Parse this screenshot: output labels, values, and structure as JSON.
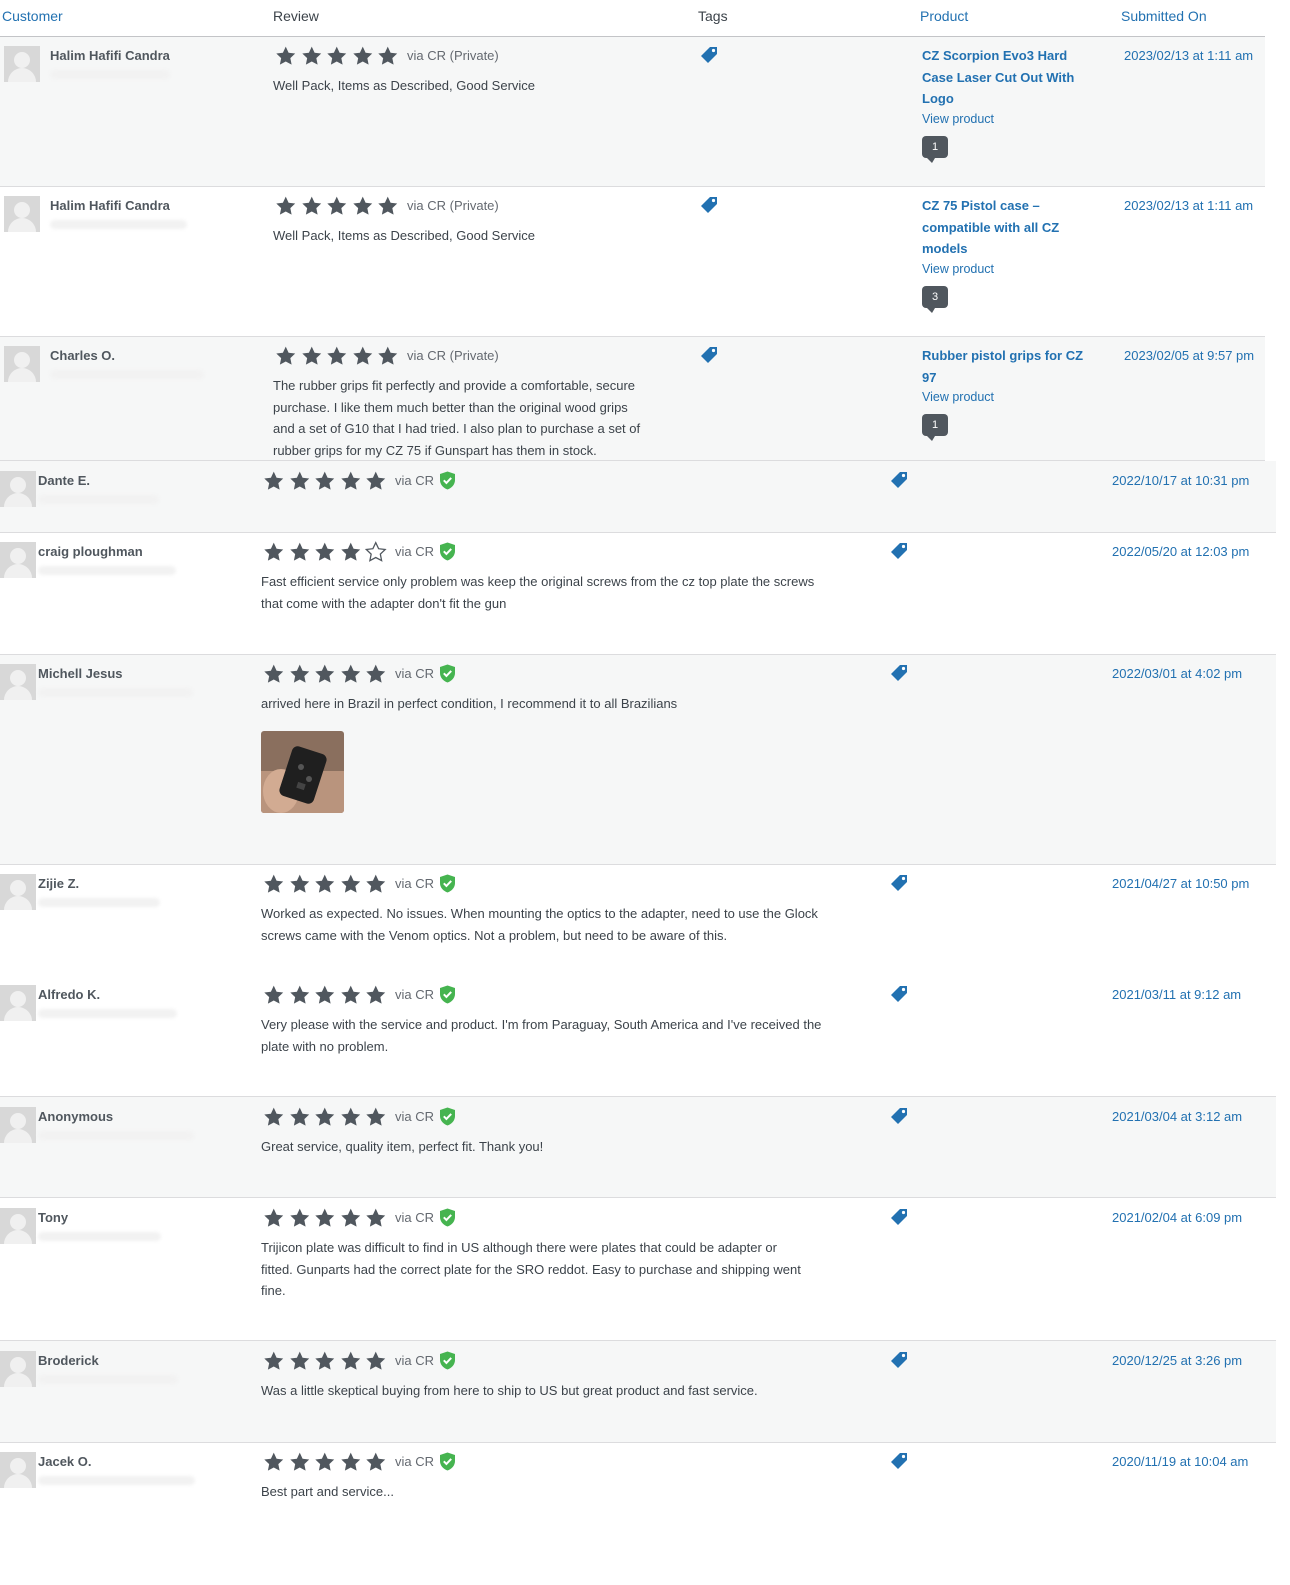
{
  "header": {
    "customer": "Customer",
    "review": "Review",
    "tags": "Tags",
    "product": "Product",
    "submitted": "Submitted On"
  },
  "colors": {
    "link": "#2271b1",
    "star": "#50575e",
    "verified": "#46b450",
    "bubble": "#50575e"
  },
  "icons": {
    "tag": "tag-icon",
    "verified": "verified-shield-icon",
    "avatar": "default-avatar-icon"
  },
  "reviews": [
    {
      "name": "Halim Hafifi Candra",
      "rating": 5,
      "via": "via CR (Private)",
      "verified": false,
      "text": "Well Pack, Items as Described, Good Service",
      "product": [
        "CZ Scorpion Evo3 Hard",
        "Case Laser Cut Out With",
        "Logo"
      ],
      "view": "View product",
      "count": "1",
      "date": "2023/02/13 at 1:11 am"
    },
    {
      "name": "Halim Hafifi Candra",
      "rating": 5,
      "via": "via CR (Private)",
      "verified": false,
      "text": "Well Pack, Items as Described, Good Service",
      "product": [
        "CZ 75 Pistol case –",
        "compatible with all CZ",
        "models"
      ],
      "view": "View product",
      "count": "3",
      "date": "2023/02/13 at 1:11 am"
    },
    {
      "name": "Charles O.",
      "rating": 5,
      "via": "via CR (Private)",
      "verified": false,
      "lines": [
        "The rubber grips fit perfectly and provide a comfortable, secure",
        "purchase. I like them much better than the original wood grips",
        "and a set of G10 that I had tried. I also plan to purchase a set of",
        "rubber grips for my CZ 75 if Gunspart has them in stock."
      ],
      "product": [
        "Rubber pistol grips for CZ",
        "97"
      ],
      "view": "View product",
      "count": "1",
      "date": "2023/02/05 at 9:57 pm"
    },
    {
      "name": "Dante E.",
      "rating": 5,
      "via": "via CR",
      "verified": true,
      "date": "2022/10/17 at 10:31 pm"
    },
    {
      "name": "craig ploughman",
      "rating": 4,
      "via": "via CR",
      "verified": true,
      "lines": [
        "Fast efficient service only problem was keep the original screws from the cz top plate the screws",
        "that come with the adapter don't fit the gun"
      ],
      "date": "2022/05/20 at 12:03 pm"
    },
    {
      "name": "Michell Jesus",
      "rating": 5,
      "via": "via CR",
      "verified": true,
      "text": "arrived here in Brazil in perfect condition, I recommend it to all Brazilians",
      "date": "2022/03/01 at 4:02 pm"
    },
    {
      "name": "Zijie Z.",
      "rating": 5,
      "via": "via CR",
      "verified": true,
      "lines": [
        "Worked as expected. No issues. When mounting the optics to the adapter, need to use the Glock",
        "screws came with the Venom optics. Not a problem, but need to be aware of this."
      ],
      "date": "2021/04/27 at 10:50 pm"
    },
    {
      "name": "Alfredo K.",
      "rating": 5,
      "via": "via CR",
      "verified": true,
      "lines": [
        "Very please with the service and product. I'm from Paraguay, South America and I've received the",
        "plate with no problem."
      ],
      "date": "2021/03/11 at 9:12 am"
    },
    {
      "name": "Anonymous",
      "rating": 5,
      "via": "via CR",
      "verified": true,
      "text": "Great service, quality item, perfect fit. Thank you!",
      "date": "2021/03/04 at 3:12 am"
    },
    {
      "name": "Tony",
      "rating": 5,
      "via": "via CR",
      "verified": true,
      "lines": [
        "Trijicon plate was difficult to find in US although there were plates that could be adapter or",
        "fitted. Gunparts had the correct plate for the SRO reddot. Easy to purchase and shipping went",
        "fine."
      ],
      "date": "2021/02/04 at 6:09 pm"
    },
    {
      "name": "Broderick",
      "rating": 5,
      "via": "via CR",
      "verified": true,
      "text": "Was a little skeptical buying from here to ship to US but great product and fast service.",
      "date": "2020/12/25 at 3:26 pm"
    },
    {
      "name": "Jacek O.",
      "rating": 5,
      "via": "via CR",
      "verified": true,
      "text": "Best part and service...",
      "date": "2020/11/19 at 10:04 am"
    }
  ]
}
